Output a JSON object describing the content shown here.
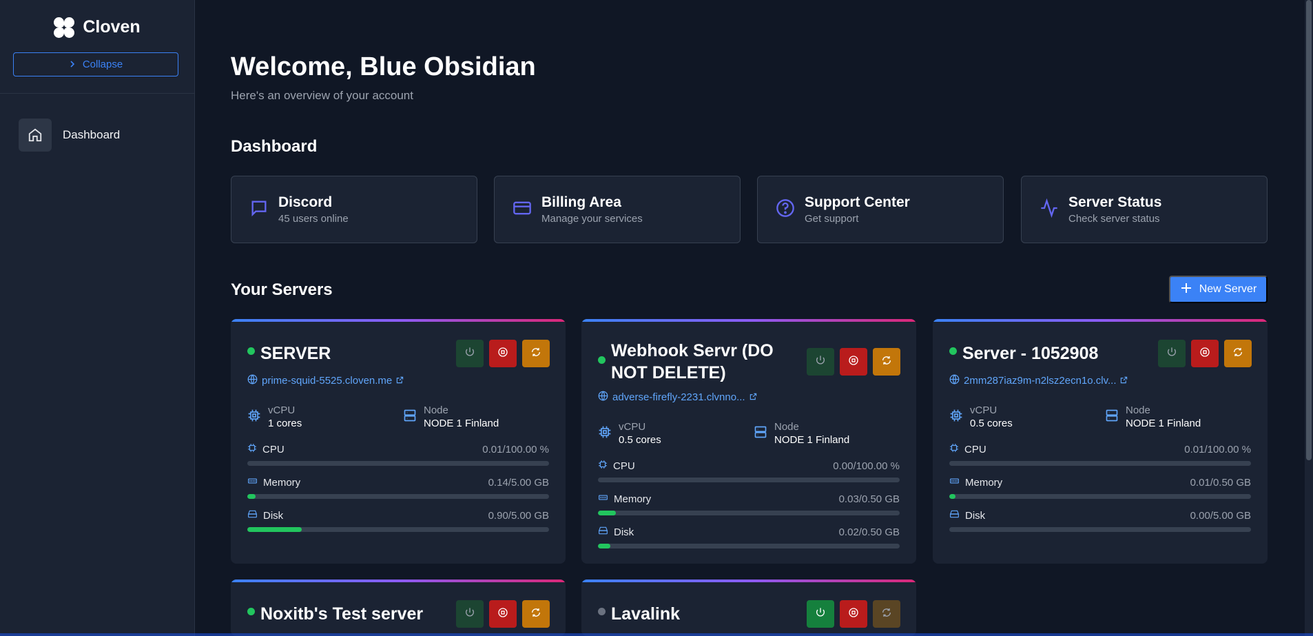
{
  "app": {
    "name": "Cloven",
    "collapse_label": "Collapse"
  },
  "sidebar": {
    "items": [
      {
        "label": "Dashboard",
        "icon": "home-icon"
      }
    ]
  },
  "header": {
    "welcome": "Welcome, Blue Obsidian",
    "subtitle": "Here's an overview of your account"
  },
  "dashboard": {
    "title": "Dashboard",
    "cards": [
      {
        "title": "Discord",
        "subtitle": "45 users online",
        "icon": "chat-icon"
      },
      {
        "title": "Billing Area",
        "subtitle": "Manage your services",
        "icon": "credit-card-icon"
      },
      {
        "title": "Support Center",
        "subtitle": "Get support",
        "icon": "help-circle-icon"
      },
      {
        "title": "Server Status",
        "subtitle": "Check server status",
        "icon": "activity-icon"
      }
    ]
  },
  "servers": {
    "title": "Your Servers",
    "new_label": "New Server",
    "labels": {
      "vcpu": "vCPU",
      "node": "Node",
      "cpu": "CPU",
      "memory": "Memory",
      "disk": "Disk"
    },
    "items": [
      {
        "name": "SERVER",
        "status": "online",
        "address": "prime-squid-5525.cloven.me",
        "vcpu": "1 cores",
        "node": "NODE 1 Finland",
        "cpu": "0.01/100.00 %",
        "cpu_pct": 0.01,
        "memory": "0.14/5.00 GB",
        "memory_pct": 2.8,
        "disk": "0.90/5.00 GB",
        "disk_pct": 18
      },
      {
        "name": "Webhook Servr (DO NOT DELETE)",
        "status": "online",
        "address": "adverse-firefly-2231.clvnno...",
        "vcpu": "0.5 cores",
        "node": "NODE 1 Finland",
        "cpu": "0.00/100.00 %",
        "cpu_pct": 0,
        "memory": "0.03/0.50 GB",
        "memory_pct": 6,
        "disk": "0.02/0.50 GB",
        "disk_pct": 4
      },
      {
        "name": "Server - 1052908",
        "status": "online",
        "address": "2mm287iaz9m-n2lsz2ecn1o.clv...",
        "vcpu": "0.5 cores",
        "node": "NODE 1 Finland",
        "cpu": "0.01/100.00 %",
        "cpu_pct": 0.01,
        "memory": "0.01/0.50 GB",
        "memory_pct": 2,
        "disk": "0.00/5.00 GB",
        "disk_pct": 0
      },
      {
        "name": "Noxitb's Test server",
        "status": "online"
      },
      {
        "name": "Lavalink",
        "status": "offline"
      }
    ]
  },
  "colors": {
    "accent": "#3b82f6",
    "online": "#22c55e",
    "offline": "#6b7280",
    "stop": "#b91c1c",
    "restart": "#c2760a"
  }
}
